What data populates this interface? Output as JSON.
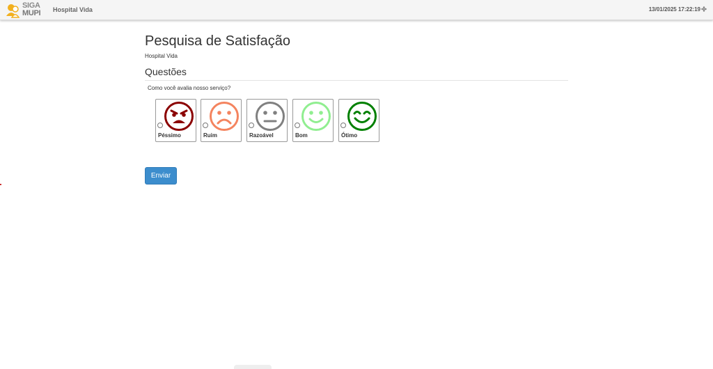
{
  "header": {
    "logo_line1": "SIGA",
    "logo_line2": "MUPI",
    "app_name": "Hospital Vida",
    "datetime": "13/01/2025 17:22:19"
  },
  "survey": {
    "title": "Pesquisa de Satisfação",
    "organization": "Hospital Vida",
    "section_title": "Questões",
    "question": "Como você avalia nosso serviço?",
    "options": [
      {
        "label": "Péssimo",
        "face": "angry-face-icon",
        "color": "#8b0000"
      },
      {
        "label": "Ruim",
        "face": "sad-face-icon",
        "color": "#f4845f"
      },
      {
        "label": "Razoável",
        "face": "neutral-face-icon",
        "color": "#808080"
      },
      {
        "label": "Bom",
        "face": "smile-face-icon",
        "color": "#90ee90"
      },
      {
        "label": "Ótimo",
        "face": "happy-face-icon",
        "color": "#008000"
      }
    ],
    "submit_label": "Enviar"
  },
  "colors": {
    "primary_button": "#3c8dcd",
    "topbar": "#f5f5f5"
  }
}
